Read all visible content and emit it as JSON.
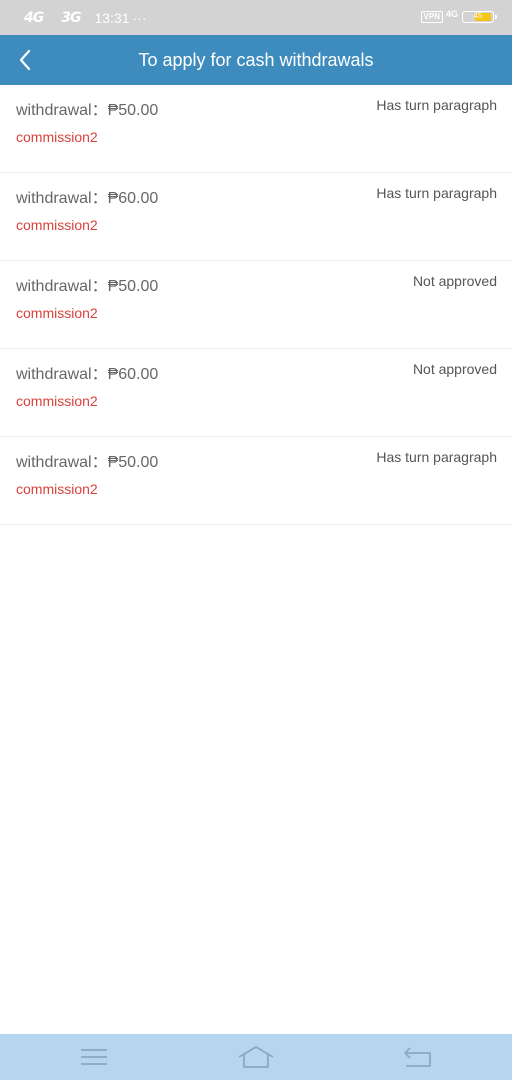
{
  "status_bar": {
    "net1": "4G",
    "net2": "3G",
    "time": "13:31",
    "more": "···",
    "vpn": "VPN",
    "net_right": "4G",
    "battery": "45"
  },
  "header": {
    "title": "To apply for cash withdrawals"
  },
  "withdrawals": [
    {
      "amount": "withdrawal：₱50.00",
      "type": "commission2",
      "status": "Has turn paragraph"
    },
    {
      "amount": "withdrawal：₱60.00",
      "type": "commission2",
      "status": "Has turn paragraph"
    },
    {
      "amount": "withdrawal：₱50.00",
      "type": "commission2",
      "status": "Not approved"
    },
    {
      "amount": "withdrawal：₱60.00",
      "type": "commission2",
      "status": "Not approved"
    },
    {
      "amount": "withdrawal：₱50.00",
      "type": "commission2",
      "status": "Has turn paragraph"
    }
  ],
  "colors": {
    "header_bg": "#3e8bbd",
    "status_bar_bg": "#d3d3d3",
    "commission_text": "#d9413b",
    "system_nav_bg": "#b5d6ee",
    "battery_fill": "#f5c518"
  },
  "icons": {
    "back": "chevron-left-icon",
    "menu": "hamburger-menu-icon",
    "home": "home-icon",
    "return": "return-arrow-icon"
  }
}
